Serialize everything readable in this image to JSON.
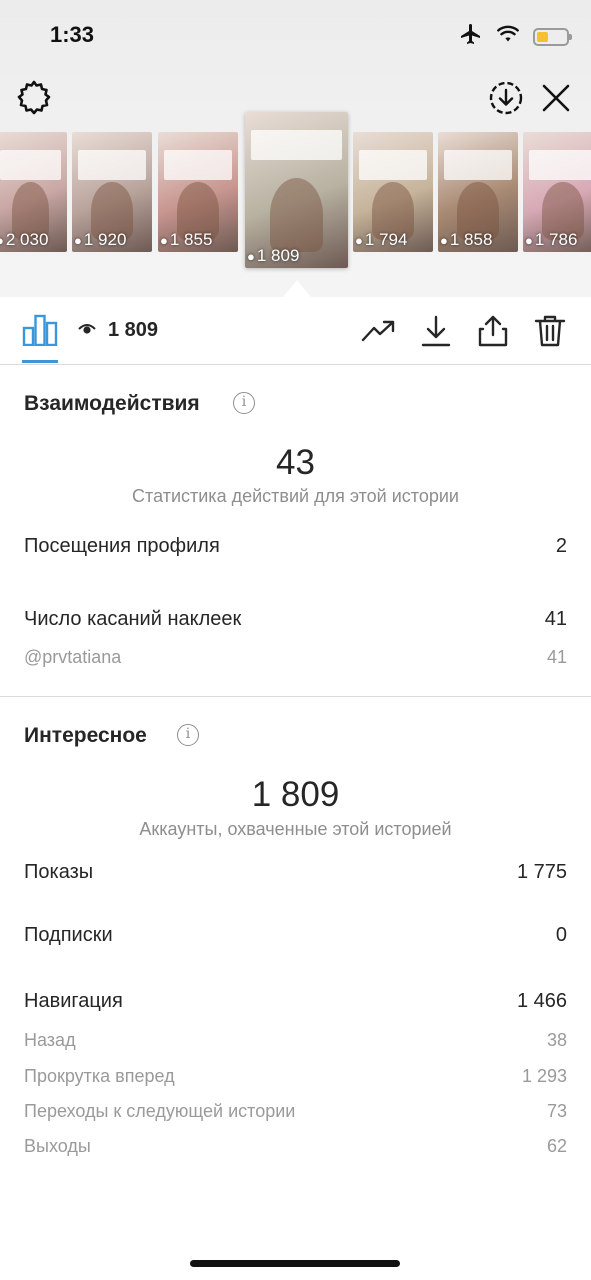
{
  "status_bar": {
    "time": "1:33",
    "battery_color": "#f4c230"
  },
  "top_actions": {
    "settings_icon": "settings-icon",
    "download_icon": "download-circle-icon",
    "close_icon": "close-icon"
  },
  "stories": [
    {
      "views": "2 030",
      "color": "#c9a7a4"
    },
    {
      "views": "1 920",
      "color": "#b9a49c"
    },
    {
      "views": "1 855",
      "color": "#c7968f"
    },
    {
      "views": "1 809",
      "color": "#b8b2a2",
      "selected": true
    },
    {
      "views": "1 794",
      "color": "#c6b49b"
    },
    {
      "views": "1 858",
      "color": "#a98b74"
    },
    {
      "views": "1 786",
      "color": "#d7a9b6"
    }
  ],
  "toolbar": {
    "views": "1 809",
    "icons": [
      "insights-bar-icon",
      "eye-icon",
      "trending-icon",
      "download-icon",
      "share-icon",
      "delete-icon"
    ]
  },
  "interactions": {
    "title": "Взаимодействия",
    "info_icon": "i",
    "total": "43",
    "caption": "Статистика действий для этой истории",
    "rows": [
      {
        "label": "Посещения профиля",
        "value": "2"
      },
      {
        "label": "Число касаний наклеек",
        "value": "41"
      }
    ],
    "sub_rows": [
      {
        "label": "@prvtatiana",
        "value": "41"
      }
    ]
  },
  "discovery": {
    "title": "Интересное",
    "info_icon": "i",
    "total": "1 809",
    "caption": "Аккаунты, охваченные этой историей",
    "rows": [
      {
        "label": "Показы",
        "value": "1 775"
      },
      {
        "label": "Подписки",
        "value": "0"
      },
      {
        "label": "Навигация",
        "value": "1 466"
      }
    ],
    "navigation": [
      {
        "label": "Назад",
        "value": "38"
      },
      {
        "label": "Прокрутка вперед",
        "value": "1 293"
      },
      {
        "label": "Переходы к следующей истории",
        "value": "73"
      },
      {
        "label": "Выходы",
        "value": "62"
      }
    ]
  }
}
